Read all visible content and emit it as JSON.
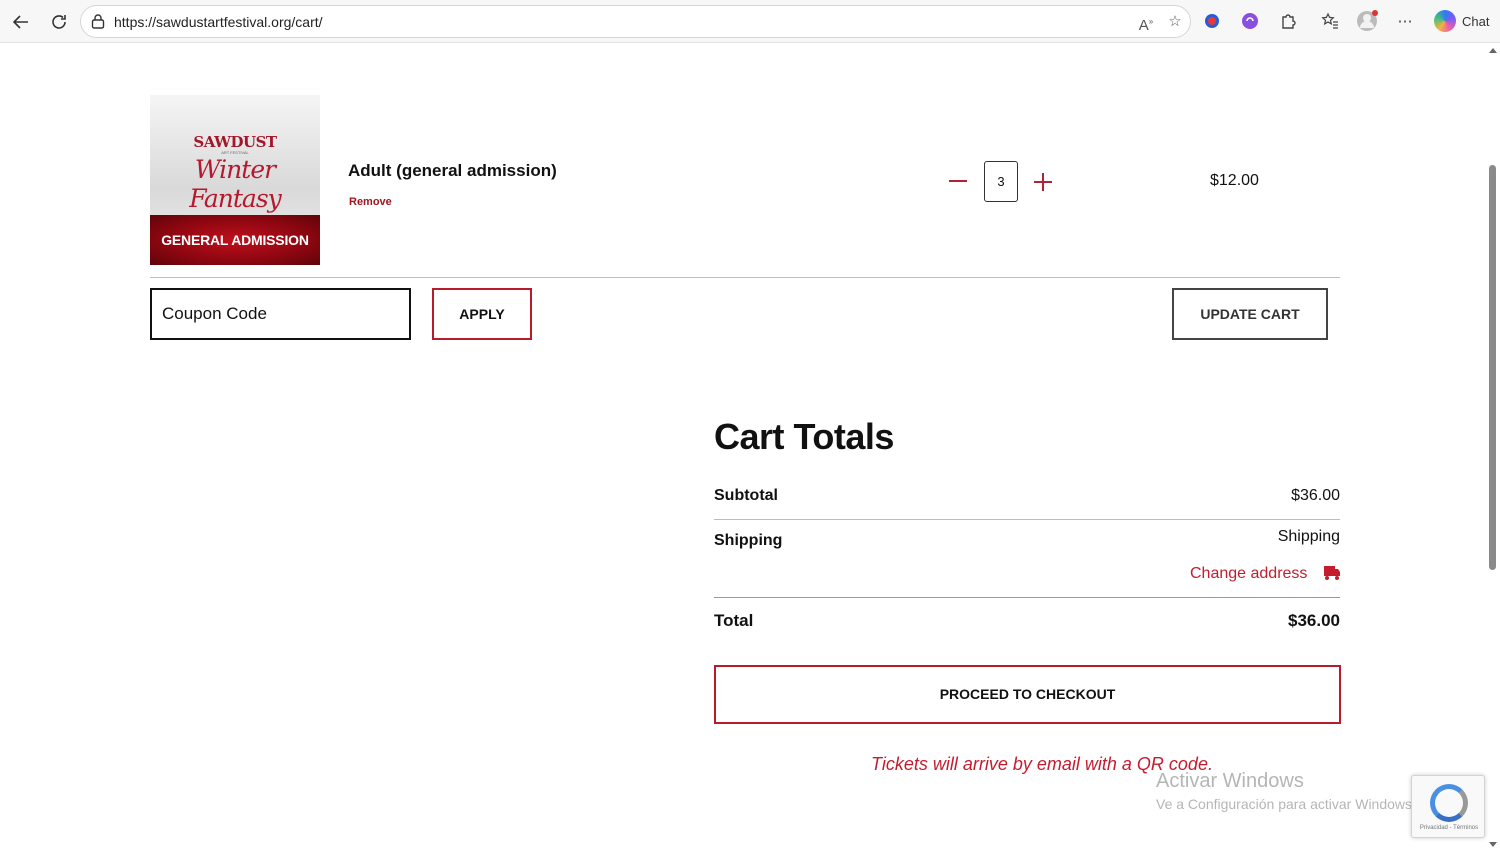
{
  "browser": {
    "url": "https://sawdustartfestival.org/cart/",
    "chat_label": "Chat"
  },
  "product": {
    "image_logo": "SAWDUST",
    "image_logo_sub": "ART FESTIVAL",
    "image_script": "Winter Fantasy",
    "image_banner": "GENERAL ADMISSION",
    "name": "Adult (general admission)",
    "remove_label": "Remove",
    "quantity": "3",
    "price": "$12.00"
  },
  "coupon": {
    "placeholder": "Coupon Code",
    "apply_label": "APPLY"
  },
  "update_cart_label": "UPDATE CART",
  "cart_totals": {
    "title": "Cart Totals",
    "subtotal_label": "Subtotal",
    "subtotal_value": "$36.00",
    "shipping_label": "Shipping",
    "shipping_value": "Shipping",
    "change_address_label": "Change address",
    "total_label": "Total",
    "total_value": "$36.00"
  },
  "checkout_label": "PROCEED TO CHECKOUT",
  "tickets_note": "Tickets will arrive by email with a QR code.",
  "windows_watermark": {
    "line1": "Activar Windows",
    "line2": "Ve a Configuración para activar Windows."
  },
  "recaptcha_text": "Privacidad - Términos",
  "colors": {
    "accent": "#b61c2c",
    "accent_text": "#c41d2f"
  }
}
